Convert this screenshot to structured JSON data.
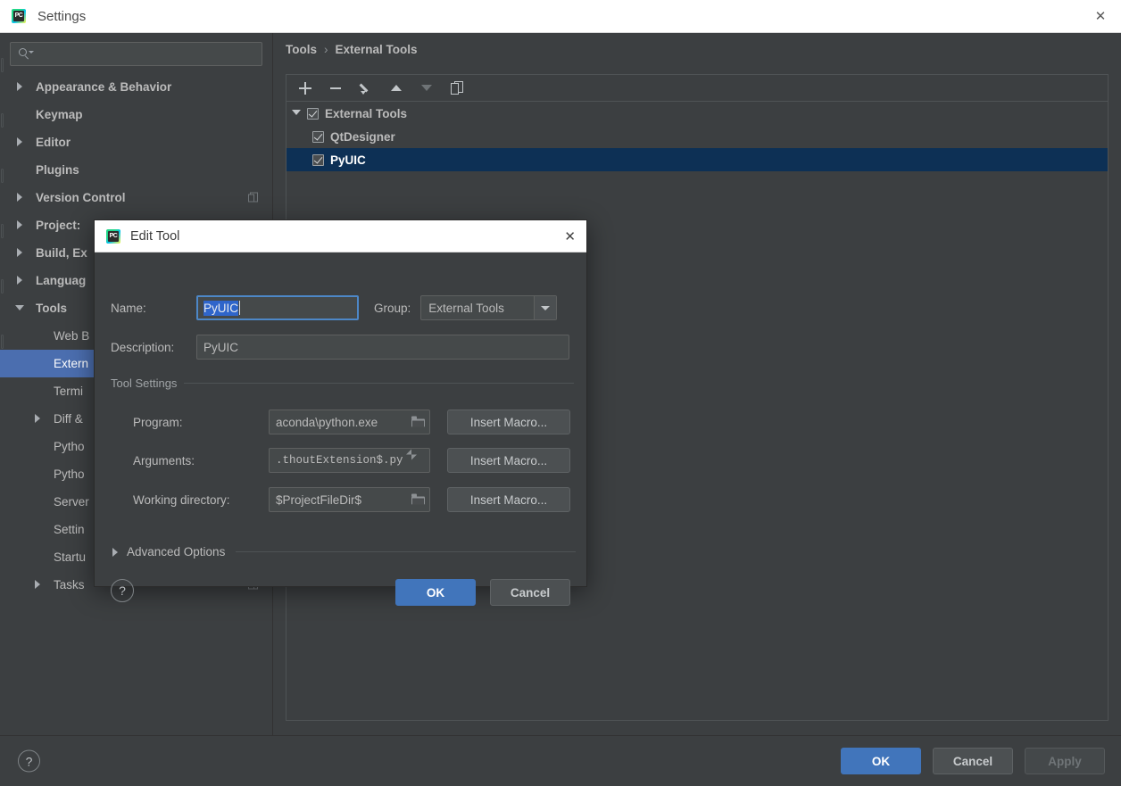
{
  "window": {
    "title": "Settings",
    "icon": "pycharm-icon",
    "close_label": "✕"
  },
  "search": {
    "value": "",
    "placeholder": ""
  },
  "sidebar": {
    "items": [
      {
        "label": "Appearance & Behavior",
        "arrow": "right",
        "level": 0,
        "selected": false,
        "badge": false
      },
      {
        "label": "Keymap",
        "arrow": "none",
        "level": 0,
        "selected": false,
        "badge": false
      },
      {
        "label": "Editor",
        "arrow": "right",
        "level": 0,
        "selected": false,
        "badge": false
      },
      {
        "label": "Plugins",
        "arrow": "none",
        "level": 0,
        "selected": false,
        "badge": false
      },
      {
        "label": "Version Control",
        "arrow": "right",
        "level": 0,
        "selected": false,
        "badge": true
      },
      {
        "label": "Project:",
        "arrow": "right",
        "level": 0,
        "selected": false,
        "badge": false
      },
      {
        "label": "Build, Ex",
        "arrow": "right",
        "level": 0,
        "selected": false,
        "badge": false
      },
      {
        "label": "Languag",
        "arrow": "right",
        "level": 0,
        "selected": false,
        "badge": false
      },
      {
        "label": "Tools",
        "arrow": "down",
        "level": 0,
        "selected": false,
        "badge": false
      },
      {
        "label": "Web B",
        "arrow": "none",
        "level": 1,
        "selected": false,
        "badge": false
      },
      {
        "label": "Extern",
        "arrow": "none",
        "level": 1,
        "selected": true,
        "badge": false
      },
      {
        "label": "Termi",
        "arrow": "none",
        "level": 1,
        "selected": false,
        "badge": false
      },
      {
        "label": "Diff &",
        "arrow": "right",
        "level": 1,
        "selected": false,
        "badge": false
      },
      {
        "label": "Pytho",
        "arrow": "none",
        "level": 1,
        "selected": false,
        "badge": false
      },
      {
        "label": "Pytho",
        "arrow": "none",
        "level": 1,
        "selected": false,
        "badge": false
      },
      {
        "label": "Server",
        "arrow": "none",
        "level": 1,
        "selected": false,
        "badge": false
      },
      {
        "label": "Settin",
        "arrow": "none",
        "level": 1,
        "selected": false,
        "badge": false
      },
      {
        "label": "Startu",
        "arrow": "none",
        "level": 1,
        "selected": false,
        "badge": false
      },
      {
        "label": "Tasks",
        "arrow": "right",
        "level": 1,
        "selected": false,
        "badge": true
      }
    ]
  },
  "main": {
    "breadcrumb": {
      "root": "Tools",
      "separator": "›",
      "current": "External Tools"
    },
    "toolbar": [
      {
        "name": "add-tool-button",
        "icon": "plus-icon",
        "enabled": true
      },
      {
        "name": "remove-tool-button",
        "icon": "minus-icon",
        "enabled": true
      },
      {
        "name": "edit-tool-button",
        "icon": "pencil-icon",
        "enabled": true
      },
      {
        "name": "move-up-button",
        "icon": "arrow-up-icon",
        "enabled": true
      },
      {
        "name": "move-down-button",
        "icon": "arrow-down-icon",
        "enabled": false
      },
      {
        "name": "copy-tool-button",
        "icon": "copy-icon",
        "enabled": true
      }
    ],
    "tree": [
      {
        "label": "External Tools",
        "level": 0,
        "checked": true,
        "expanded": true,
        "selected": false
      },
      {
        "label": "QtDesigner",
        "level": 1,
        "checked": true,
        "expanded": null,
        "selected": false
      },
      {
        "label": "PyUIC",
        "level": 1,
        "checked": true,
        "expanded": null,
        "selected": true
      }
    ]
  },
  "bottom": {
    "help_label": "?",
    "ok_label": "OK",
    "cancel_label": "Cancel",
    "apply_label": "Apply"
  },
  "dialog": {
    "title": "Edit Tool",
    "icon": "pycharm-icon",
    "close_label": "✕",
    "name_label": "Name:",
    "name_value": "PyUIC",
    "group_label": "Group:",
    "group_value": "External Tools",
    "description_label": "Description:",
    "description_value": "PyUIC",
    "tool_settings_label": "Tool Settings",
    "program_label": "Program:",
    "program_value": "aconda\\python.exe",
    "arguments_label": "Arguments:",
    "arguments_value": ".thoutExtension$.py",
    "working_dir_label": "Working directory:",
    "working_dir_value": "$ProjectFileDir$",
    "insert_macro_label": "Insert Macro...",
    "advanced_options_label": "Advanced Options",
    "help_label": "?",
    "ok_label": "OK",
    "cancel_label": "Cancel"
  },
  "colors": {
    "window_bg": "#3c3f41",
    "titlebar_bg": "#ffffff",
    "accent_blue": "#4175bb",
    "sidebar_selection": "#4b6eaf",
    "tree_selection": "#0d3055",
    "text": "#bbbbbb",
    "field_bg": "#45494a",
    "focus_border": "#4d87c7",
    "text_selection": "#2f65ca"
  }
}
